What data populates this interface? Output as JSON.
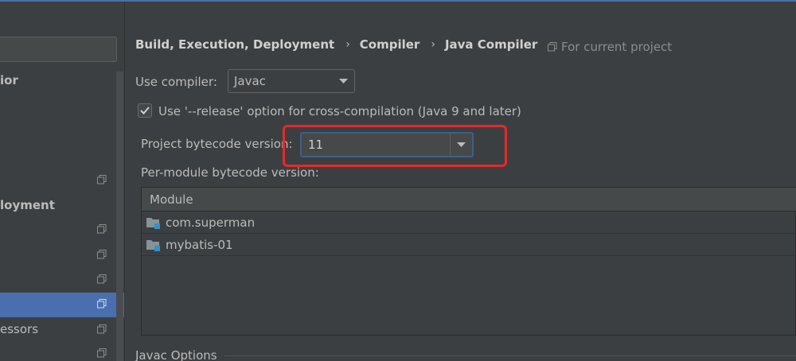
{
  "sidebar": {
    "items": [
      {
        "label": "ior",
        "bold": true
      },
      {
        "label": "",
        "copy_icon": true
      },
      {
        "label": "loyment",
        "bold": true
      },
      {
        "label": "",
        "copy_icon": true
      },
      {
        "label": "",
        "copy_icon": true
      },
      {
        "label": "",
        "copy_icon": true
      },
      {
        "label": "",
        "copy_icon": true,
        "selected": true
      },
      {
        "label": "essors",
        "copy_icon": true
      },
      {
        "label": "",
        "copy_icon": true
      }
    ]
  },
  "breadcrumb": {
    "item1": "Build, Execution, Deployment",
    "item2": "Compiler",
    "item3": "Java Compiler",
    "separator": "›"
  },
  "scope_note": "For current project",
  "use_compiler": {
    "label": "Use compiler:",
    "value": "Javac"
  },
  "release_option": {
    "label": "Use '--release' option for cross-compilation (Java 9 and later)",
    "checked": true
  },
  "project_bytecode": {
    "label": "Project bytecode version:",
    "value": "11"
  },
  "per_module": {
    "label": "Per-module bytecode version:",
    "column_header": "Module",
    "rows": [
      "com.superman",
      "mybatis-01"
    ]
  },
  "javac_options": {
    "title": "Javac Options"
  },
  "colors": {
    "accent": "#4b6eaf",
    "highlight": "#e8282b",
    "background": "#3c3f41"
  }
}
